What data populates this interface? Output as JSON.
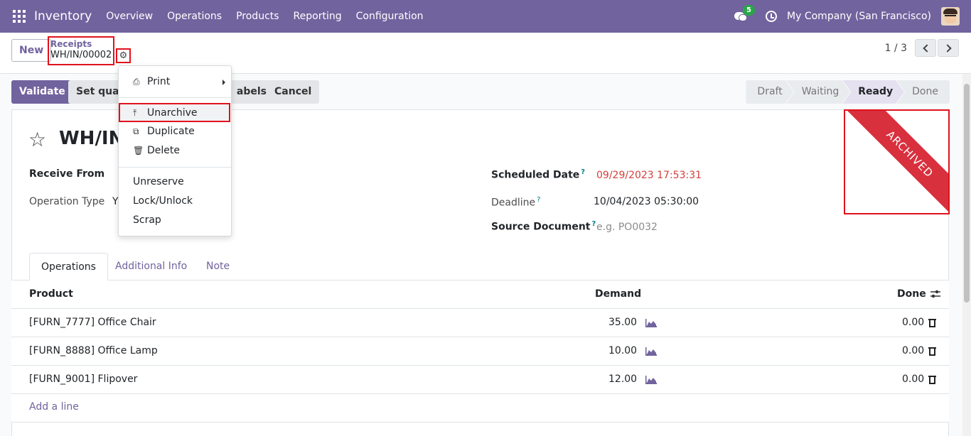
{
  "navbar": {
    "app_name": "Inventory",
    "menu": [
      "Overview",
      "Operations",
      "Products",
      "Reporting",
      "Configuration"
    ],
    "messages_badge": "5",
    "company": "My Company (San Francisco)"
  },
  "control_panel": {
    "new_label": "New",
    "breadcrumb_parent": "Receipts",
    "breadcrumb_current": "WH/IN/00002",
    "pager": "1 / 3"
  },
  "action_menu": {
    "print": "Print",
    "unarchive": "Unarchive",
    "duplicate": "Duplicate",
    "delete": "Delete",
    "unreserve": "Unreserve",
    "lock_unlock": "Lock/Unlock",
    "scrap": "Scrap"
  },
  "statusbar": {
    "validate": "Validate",
    "set_quantities": "Set quanti",
    "print_labels": "abels",
    "cancel": "Cancel",
    "stages": [
      "Draft",
      "Waiting",
      "Ready",
      "Done"
    ],
    "active_stage": "Ready"
  },
  "form": {
    "title": "WH/IN",
    "receive_from_label": "Receive From",
    "operation_type_label": "Operation Type",
    "operation_type_value": "Y",
    "scheduled_date_label": "Scheduled Date",
    "scheduled_date_value": "09/29/2023 17:53:31",
    "deadline_label": "Deadline",
    "deadline_value": "10/04/2023 05:30:00",
    "source_document_label": "Source Document",
    "source_document_placeholder": "e.g. PO0032",
    "help_mark": "?",
    "ribbon": "ARCHIVED"
  },
  "tabs": [
    "Operations",
    "Additional Info",
    "Note"
  ],
  "table": {
    "headers": {
      "product": "Product",
      "demand": "Demand",
      "done": "Done"
    },
    "rows": [
      {
        "product": "[FURN_7777] Office Chair",
        "demand": "35.00",
        "done": "0.00"
      },
      {
        "product": "[FURN_8888] Office Lamp",
        "demand": "10.00",
        "done": "0.00"
      },
      {
        "product": "[FURN_9001] Flipover",
        "demand": "12.00",
        "done": "0.00"
      }
    ],
    "add_line": "Add a line"
  },
  "colors": {
    "brand": "#71639e",
    "ribbon": "#d9303e",
    "deadline_red": "#d23f3a",
    "highlight_box": "#e0121b"
  }
}
